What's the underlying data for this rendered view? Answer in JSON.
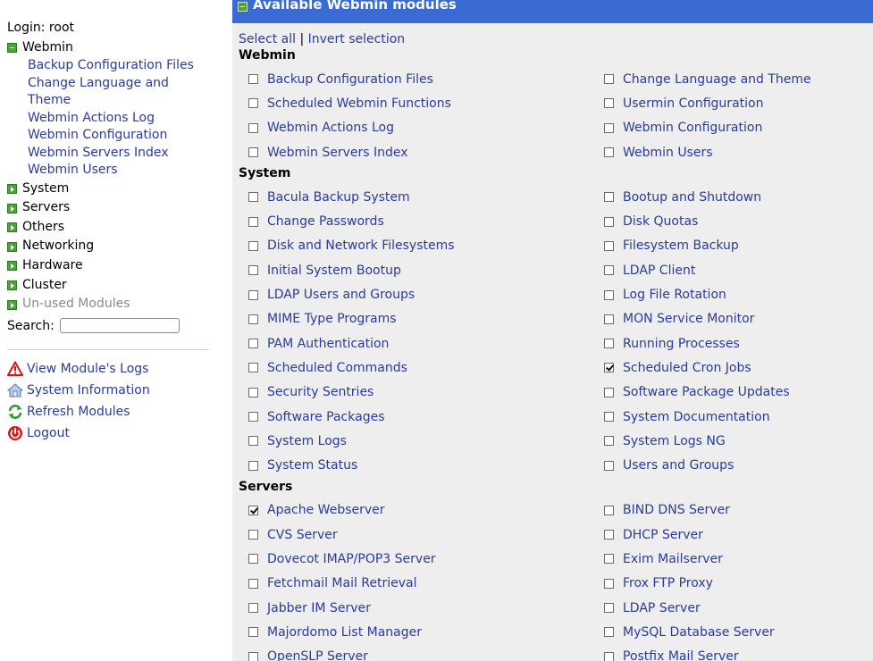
{
  "sidebar": {
    "login": "Login: root",
    "categories": [
      {
        "name": "Webmin",
        "open": true,
        "items": [
          "Backup Configuration Files",
          "Change Language and Theme",
          "Webmin Actions Log",
          "Webmin Configuration",
          "Webmin Servers Index",
          "Webmin Users"
        ]
      },
      {
        "name": "System",
        "open": false
      },
      {
        "name": "Servers",
        "open": false
      },
      {
        "name": "Others",
        "open": false
      },
      {
        "name": "Networking",
        "open": false
      },
      {
        "name": "Hardware",
        "open": false
      },
      {
        "name": "Cluster",
        "open": false
      },
      {
        "name": "Un-used Modules",
        "open": false
      }
    ],
    "search_label": "Search:",
    "search_value": "",
    "actions": [
      {
        "label": "View Module's Logs",
        "icon": "warning-icon"
      },
      {
        "label": "System Information",
        "icon": "house-icon"
      },
      {
        "label": "Refresh Modules",
        "icon": "refresh-icon"
      },
      {
        "label": "Logout",
        "icon": "power-icon"
      }
    ]
  },
  "panel": {
    "title": "Available Webmin modules",
    "select_all": "Select all",
    "separator": "|",
    "invert_selection": "Invert selection",
    "sections": [
      {
        "title": "Webmin",
        "modules": [
          {
            "label": "Backup Configuration Files",
            "checked": false
          },
          {
            "label": "Change Language and Theme",
            "checked": false
          },
          {
            "label": "Scheduled Webmin Functions",
            "checked": false
          },
          {
            "label": "Usermin Configuration",
            "checked": false
          },
          {
            "label": "Webmin Actions Log",
            "checked": false
          },
          {
            "label": "Webmin Configuration",
            "checked": false
          },
          {
            "label": "Webmin Servers Index",
            "checked": false
          },
          {
            "label": "Webmin Users",
            "checked": false
          }
        ]
      },
      {
        "title": "System",
        "modules": [
          {
            "label": "Bacula Backup System",
            "checked": false
          },
          {
            "label": "Bootup and Shutdown",
            "checked": false
          },
          {
            "label": "Change Passwords",
            "checked": false
          },
          {
            "label": "Disk Quotas",
            "checked": false
          },
          {
            "label": "Disk and Network Filesystems",
            "checked": false
          },
          {
            "label": "Filesystem Backup",
            "checked": false
          },
          {
            "label": "Initial System Bootup",
            "checked": false
          },
          {
            "label": "LDAP Client",
            "checked": false
          },
          {
            "label": "LDAP Users and Groups",
            "checked": false
          },
          {
            "label": "Log File Rotation",
            "checked": false
          },
          {
            "label": "MIME Type Programs",
            "checked": false
          },
          {
            "label": "MON Service Monitor",
            "checked": false
          },
          {
            "label": "PAM Authentication",
            "checked": false
          },
          {
            "label": "Running Processes",
            "checked": false
          },
          {
            "label": "Scheduled Commands",
            "checked": false
          },
          {
            "label": "Scheduled Cron Jobs",
            "checked": true
          },
          {
            "label": "Security Sentries",
            "checked": false
          },
          {
            "label": "Software Package Updates",
            "checked": false
          },
          {
            "label": "Software Packages",
            "checked": false
          },
          {
            "label": "System Documentation",
            "checked": false
          },
          {
            "label": "System Logs",
            "checked": false
          },
          {
            "label": "System Logs NG",
            "checked": false
          },
          {
            "label": "System Status",
            "checked": false
          },
          {
            "label": "Users and Groups",
            "checked": false
          }
        ]
      },
      {
        "title": "Servers",
        "modules": [
          {
            "label": "Apache Webserver",
            "checked": true
          },
          {
            "label": "BIND DNS Server",
            "checked": false
          },
          {
            "label": "CVS Server",
            "checked": false
          },
          {
            "label": "DHCP Server",
            "checked": false
          },
          {
            "label": "Dovecot IMAP/POP3 Server",
            "checked": false
          },
          {
            "label": "Exim Mailserver",
            "checked": false
          },
          {
            "label": "Fetchmail Mail Retrieval",
            "checked": false
          },
          {
            "label": "Frox FTP Proxy",
            "checked": false
          },
          {
            "label": "Jabber IM Server",
            "checked": false
          },
          {
            "label": "LDAP Server",
            "checked": false
          },
          {
            "label": "Majordomo List Manager",
            "checked": false
          },
          {
            "label": "MySQL Database Server",
            "checked": false
          },
          {
            "label": "OpenSLP Server",
            "checked": false
          },
          {
            "label": "Postfix Mail Server",
            "checked": false
          }
        ]
      }
    ]
  }
}
